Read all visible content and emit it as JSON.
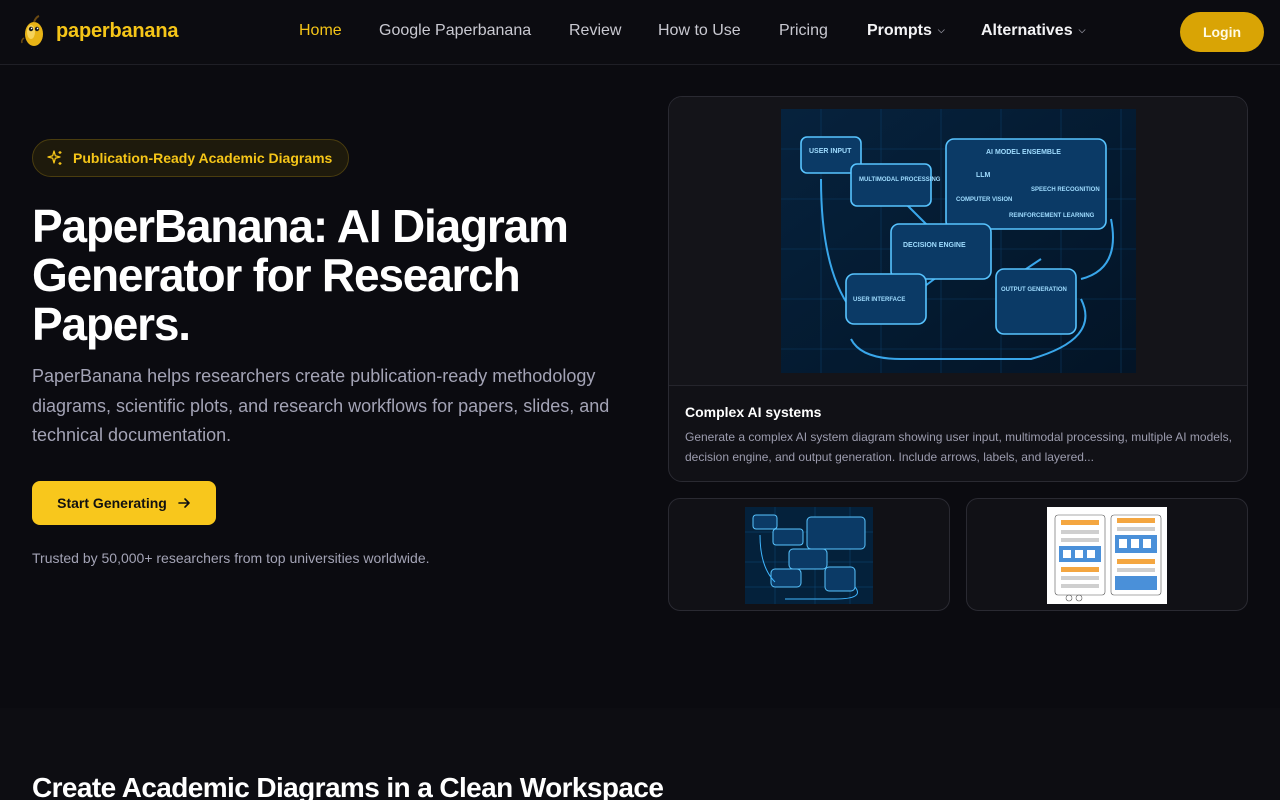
{
  "brand": {
    "name": "paperbanana",
    "accent": "#f5c518"
  },
  "nav": {
    "links": [
      {
        "label": "Home",
        "active": true
      },
      {
        "label": "Google Paperbanana"
      },
      {
        "label": "Review"
      },
      {
        "label": "How to Use"
      },
      {
        "label": "Pricing"
      },
      {
        "label": "Prompts",
        "dropdown": true
      },
      {
        "label": "Alternatives",
        "dropdown": true
      }
    ],
    "login_label": "Login"
  },
  "hero": {
    "badge": "Publication-Ready Academic Diagrams",
    "title": "PaperBanana: AI Diagram Generator for Research Papers.",
    "description": "PaperBanana helps researchers create publication-ready methodology diagrams, scientific plots, and research workflows for papers, slides, and technical documentation.",
    "cta_label": "Start Generating",
    "trusted": "Trusted by 50,000+ researchers from top universities worldwide."
  },
  "showcase": {
    "main_card": {
      "title": "Complex AI systems",
      "description": "Generate a complex AI system diagram showing user input, multimodal processing, multiple AI models, decision engine, and output generation. Include arrows, labels, and layered...",
      "diagram_labels": [
        "USER INPUT",
        "MULTIMODAL PROCESSING",
        "AI MODEL ENSEMBLE",
        "LLM",
        "COMPUTER VISION",
        "SPEECH RECOGNITION",
        "REINFORCEMENT LEARNING",
        "DECISION ENGINE",
        "USER INTERFACE",
        "OUTPUT GENERATION"
      ]
    }
  },
  "section2": {
    "title": "Create Academic Diagrams in a Clean Workspace"
  }
}
